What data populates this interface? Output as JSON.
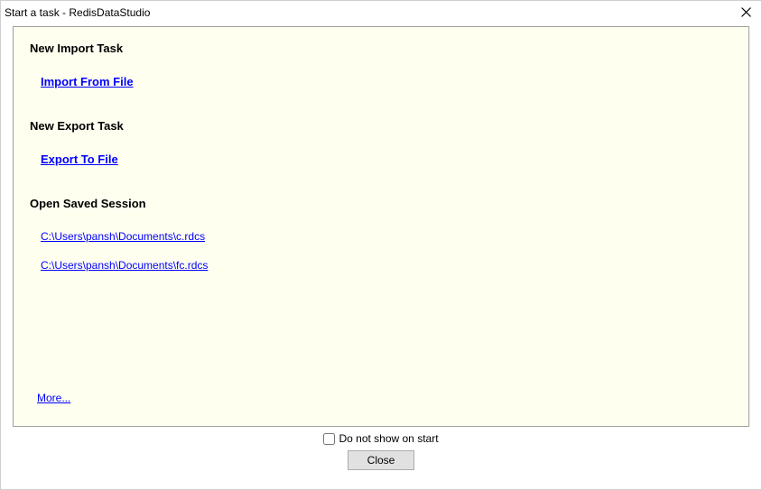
{
  "window": {
    "title": "Start a task - RedisDataStudio"
  },
  "sections": {
    "import": {
      "heading": "New Import Task",
      "link": "Import From File"
    },
    "export": {
      "heading": "New Export Task",
      "link": "Export To File"
    },
    "sessions": {
      "heading": "Open Saved Session",
      "items": [
        "C:\\Users\\pansh\\Documents\\c.rdcs",
        "C:\\Users\\pansh\\Documents\\fc.rdcs"
      ]
    },
    "more": "More..."
  },
  "footer": {
    "checkbox_label": "Do not show on start",
    "close_label": "Close"
  }
}
